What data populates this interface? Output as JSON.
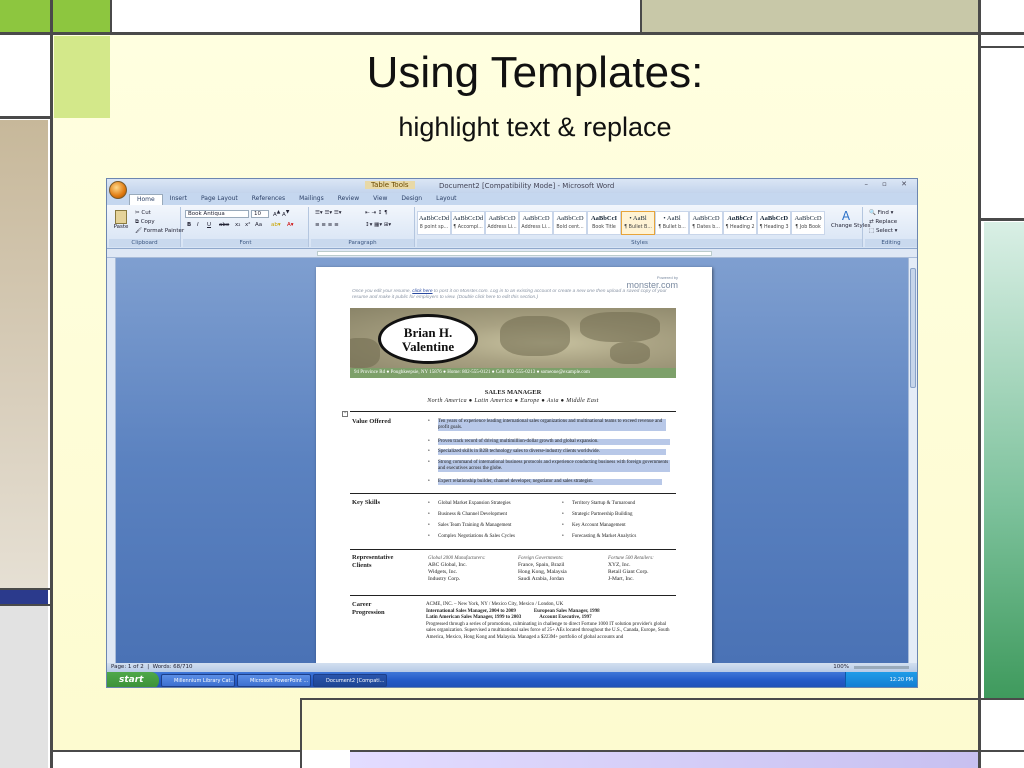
{
  "slide": {
    "title": "Using Templates:",
    "subtitle": "highlight text & replace"
  },
  "word": {
    "title_bar": {
      "context_tab": "Table Tools",
      "document_title": "Document2 [Compatibility Mode] - Microsoft Word",
      "window_buttons": "– ▫ ✕"
    },
    "tabs": [
      "Home",
      "Insert",
      "Page Layout",
      "References",
      "Mailings",
      "Review",
      "View",
      "Design",
      "Layout"
    ],
    "ribbon": {
      "clipboard": {
        "paste": "Paste",
        "cut": "Cut",
        "copy": "Copy",
        "format_painter": "Format Painter",
        "label": "Clipboard"
      },
      "font": {
        "name": "Book Antiqua",
        "size": "10",
        "label": "Font"
      },
      "paragraph": {
        "label": "Paragraph"
      },
      "styles": {
        "label": "Styles",
        "items": [
          {
            "sample": "AaBbCcDd",
            "name": "8 point sp..."
          },
          {
            "sample": "AaBbCcDd",
            "name": "¶ Accompl..."
          },
          {
            "sample": "AaBbCcD",
            "name": "Address Li..."
          },
          {
            "sample": "AaBbCcD",
            "name": "Address Li..."
          },
          {
            "sample": "AaBbCcD",
            "name": "Bold cent..."
          },
          {
            "sample": "AaBbCcI",
            "name": "Book Title"
          },
          {
            "sample": "• AaBl",
            "name": "¶ Bullet B..."
          },
          {
            "sample": "• AaBl",
            "name": "¶ Bullet b..."
          },
          {
            "sample": "AaBbCcD",
            "name": "¶ Dates b..."
          },
          {
            "sample": "AaBbCcI",
            "name": "¶ Heading 2"
          },
          {
            "sample": "AaBbCcD",
            "name": "¶ Heading 3"
          },
          {
            "sample": "AaBbCcD",
            "name": "¶ Job Book"
          }
        ],
        "change_styles": "Change Styles"
      },
      "editing": {
        "find": "Find",
        "replace": "Replace",
        "select": "Select",
        "label": "Editing"
      }
    },
    "document": {
      "powered_by": "Powered by",
      "monster": "monster.com",
      "note_pre": "Once you edit your resume, ",
      "note_link": "click here",
      "note_post": " to post it on Monster.com. Log in to an existing account or create a new one then upload a saved copy of your resume and make it public for employers to view. (Double click here to edit this section.)",
      "name_line1": "Brian H.",
      "name_line2": "Valentine",
      "contact": "94 Province Rd ● Poughkeepsie, NY 15876 ● Home: 802-555-0121 ● Cell: 802-555-0213 ● someone@example.com",
      "headline": "SALES MANAGER",
      "regions": "North America  ●  Latin America  ●  Europe  ●  Asia  ●  Middle East",
      "value_offered": {
        "heading": "Value Offered",
        "bullets": [
          "Ten years of experience leading international sales organizations and multinational teams to exceed revenue and profit goals.",
          "Proven track record of driving multimillion-dollar growth and global expansion.",
          "Specialized skills in B2B technology sales to diverse-industry clients worldwide.",
          "Strong command of international business protocols and experience conducting business with foreign governments and executives across the globe.",
          "Expert relationship builder, channel developer, negotiator and sales strategist."
        ]
      },
      "key_skills": {
        "heading": "Key Skills",
        "left": [
          "Global Market Expansion Strategies",
          "Business & Channel Development",
          "Sales Team Training & Management",
          "Complex Negotiations & Sales Cycles"
        ],
        "right": [
          "Territory Startup & Turnaround",
          "Strategic Partnership Building",
          "Key Account Management",
          "Forecasting & Market Analytics"
        ]
      },
      "clients": {
        "heading_line1": "Representative",
        "heading_line2": "Clients",
        "cols": [
          {
            "title": "Global 2000 Manufacturers:",
            "items": [
              "ABC Global, Inc.",
              "Widgets, Inc.",
              "Industry Corp."
            ]
          },
          {
            "title": "Foreign Governments:",
            "items": [
              "France, Spain, Brazil",
              "Hong Kong, Malaysia",
              "Saudi Arabia, Jordan"
            ]
          },
          {
            "title": "Fortune 500 Retailers:",
            "items": [
              "XYZ, Inc.",
              "Retail Giant Corp.",
              "J-Mart, Inc."
            ]
          }
        ]
      },
      "career": {
        "heading_line1": "Career",
        "heading_line2": "Progression",
        "company": "ACME, INC.  –  New York, NY / Mexico City, Mexico / London, UK",
        "role1": "International Sales Manager, 2004 to 2009",
        "role2": "European Sales Manager, 1998",
        "role3": "Latin American Sales Manager, 1999 to 2003",
        "role4": "Account Executive, 1997",
        "text": "Progressed through a series of promotions, culminating in challenge to direct Fortune 1000 IT solution provider's global sales organization. Supervised a multinational sales force of 25+ AEs located throughout the U.S., Canada, Europe, South America, Mexico, Hong Kong and Malaysia. Managed a $223M+ portfolio of global accounts and"
      }
    },
    "status_bar": {
      "page": "Page: 1 of 2",
      "words": "Words: 68/710",
      "zoom": "100%"
    },
    "taskbar": {
      "start": "start",
      "tasks": [
        "Millennium Library Cat...",
        "Microsoft PowerPoint ...",
        "Document2 [Compati..."
      ],
      "clock": "12:20 PM"
    }
  }
}
